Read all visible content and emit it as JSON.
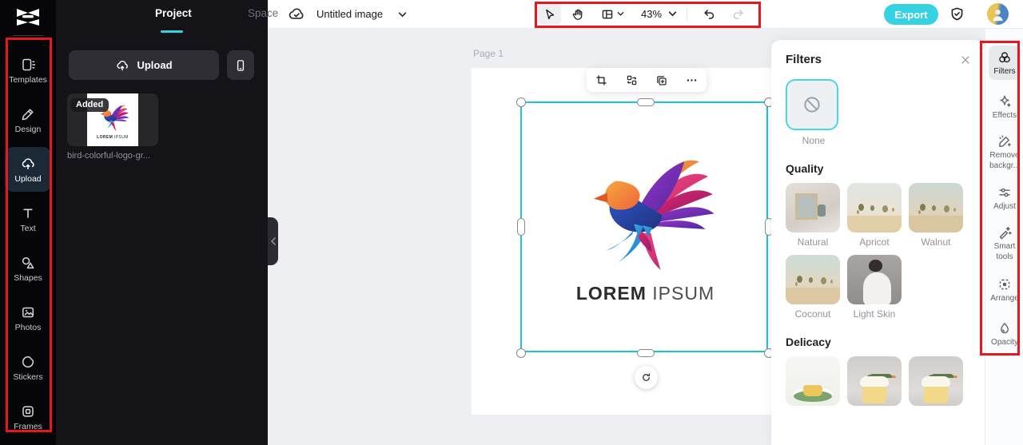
{
  "left_nav": {
    "items": [
      {
        "label": "Templates"
      },
      {
        "label": "Design"
      },
      {
        "label": "Upload",
        "active": true
      },
      {
        "label": "Text"
      },
      {
        "label": "Shapes"
      },
      {
        "label": "Photos"
      },
      {
        "label": "Stickers"
      },
      {
        "label": "Frames"
      }
    ]
  },
  "project_panel": {
    "tabs": [
      {
        "label": "Project",
        "active": true
      },
      {
        "label": "Space"
      }
    ],
    "upload_button_label": "Upload",
    "added_badge": "Added",
    "file_name": "bird-colorful-logo-gr..."
  },
  "top_bar": {
    "title": "Untitled image",
    "zoom_level": "43%",
    "export_label": "Export"
  },
  "canvas": {
    "page_label": "Page 1",
    "artwork_text_bold": "LOREM",
    "artwork_text_light": " IPSUM"
  },
  "filters_panel": {
    "title": "Filters",
    "none_label": "None",
    "quality": {
      "title": "Quality",
      "items": [
        {
          "label": "Natural"
        },
        {
          "label": "Apricot"
        },
        {
          "label": "Walnut"
        },
        {
          "label": "Coconut"
        },
        {
          "label": "Light Skin"
        }
      ]
    },
    "delicacy": {
      "title": "Delicacy"
    }
  },
  "right_rail": {
    "items": [
      {
        "label": "Filters",
        "active": true
      },
      {
        "label": "Effects"
      },
      {
        "label": "Remove",
        "label2": "backgr..."
      },
      {
        "label": "Adjust"
      },
      {
        "label": "Smart",
        "label2": "tools"
      },
      {
        "label": "Arrange"
      },
      {
        "label": "Opacity"
      }
    ]
  },
  "colors": {
    "accent_cyan": "#35d3e2",
    "selection_cyan": "#19c5d6",
    "annotation_red": "#ea161d"
  }
}
